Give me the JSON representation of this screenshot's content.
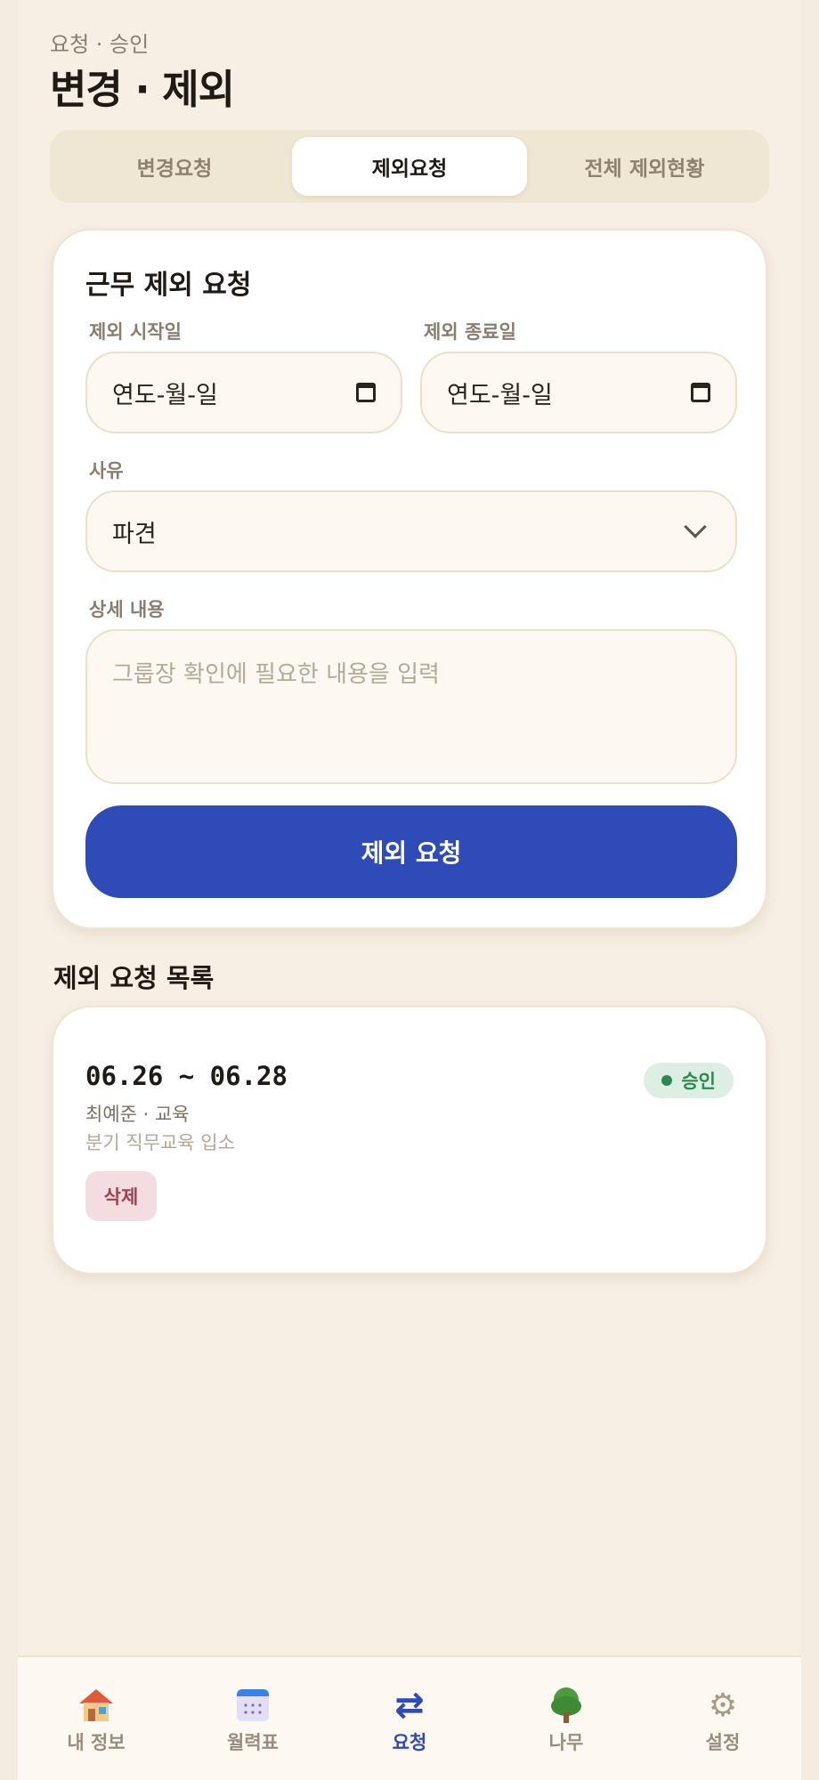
{
  "header": {
    "eyebrow": "요청 · 승인",
    "title": "변경 · 제외"
  },
  "tabs": [
    {
      "label": "변경요청",
      "active": false
    },
    {
      "label": "제외요청",
      "active": true
    },
    {
      "label": "전체 제외현황",
      "active": false
    }
  ],
  "form": {
    "title": "근무 제외 요청",
    "start_label": "제외 시작일",
    "start_value": "연도-월-일",
    "end_label": "제외 종료일",
    "end_value": "연도-월-일",
    "reason_label": "사유",
    "reason_value": "파견",
    "detail_label": "상세 내용",
    "detail_placeholder": "그룹장 확인에 필요한 내용을 입력",
    "submit_label": "제외 요청"
  },
  "list": {
    "title": "제외 요청 목록",
    "items": [
      {
        "range": "06.26 ~ 06.28",
        "who": "최예준 · 교육",
        "note": "분기 직무교육 입소",
        "status": "승인",
        "delete_label": "삭제"
      }
    ]
  },
  "nav": [
    {
      "label": "내 정보",
      "icon": "house-icon",
      "active": false
    },
    {
      "label": "월력표",
      "icon": "calendar-icon",
      "active": false
    },
    {
      "label": "요청",
      "icon": "swap-icon",
      "active": true
    },
    {
      "label": "나무",
      "icon": "tree-icon",
      "active": false
    },
    {
      "label": "설정",
      "icon": "gear-icon",
      "active": false
    }
  ],
  "colors": {
    "background": "#f7efe4",
    "accent": "#2f4bb8",
    "approved": "#2b8a4f",
    "delete": "#a0414f"
  }
}
